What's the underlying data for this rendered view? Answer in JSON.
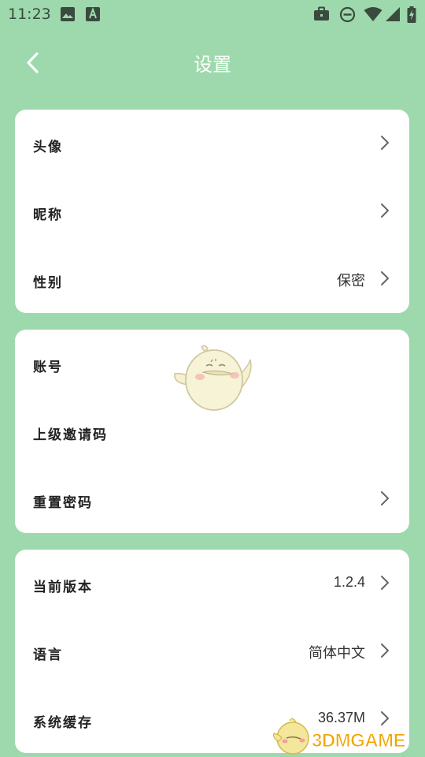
{
  "status_bar": {
    "time": "11:23",
    "left_icons": [
      "image-icon",
      "text-a-icon"
    ],
    "right_icons": [
      "briefcase-icon",
      "do-not-disturb-icon",
      "wifi-icon",
      "signal-icon",
      "battery-charging-icon"
    ]
  },
  "header": {
    "title": "设置",
    "back_icon": "chevron-left-icon"
  },
  "cards": [
    {
      "rows": [
        {
          "label": "头像",
          "value": "",
          "chevron": true
        },
        {
          "label": "昵称",
          "value": "",
          "chevron": true
        },
        {
          "label": "性别",
          "value": "保密",
          "chevron": true
        }
      ]
    },
    {
      "rows": [
        {
          "label": "账号",
          "value": "",
          "chevron": false
        },
        {
          "label": "上级邀请码",
          "value": "",
          "chevron": false
        },
        {
          "label": "重置密码",
          "value": "",
          "chevron": true
        }
      ]
    },
    {
      "rows": [
        {
          "label": "当前版本",
          "value": "1.2.4",
          "chevron": true
        },
        {
          "label": "语言",
          "value": "简体中文",
          "chevron": true
        },
        {
          "label": "系统缓存",
          "value": "36.37M",
          "chevron": true
        }
      ]
    }
  ],
  "watermark": {
    "text": "3DMGAME"
  },
  "colors": {
    "background": "#9dd9ac",
    "card": "#ffffff",
    "title": "#ffffff",
    "watermark": "#f2a400"
  }
}
